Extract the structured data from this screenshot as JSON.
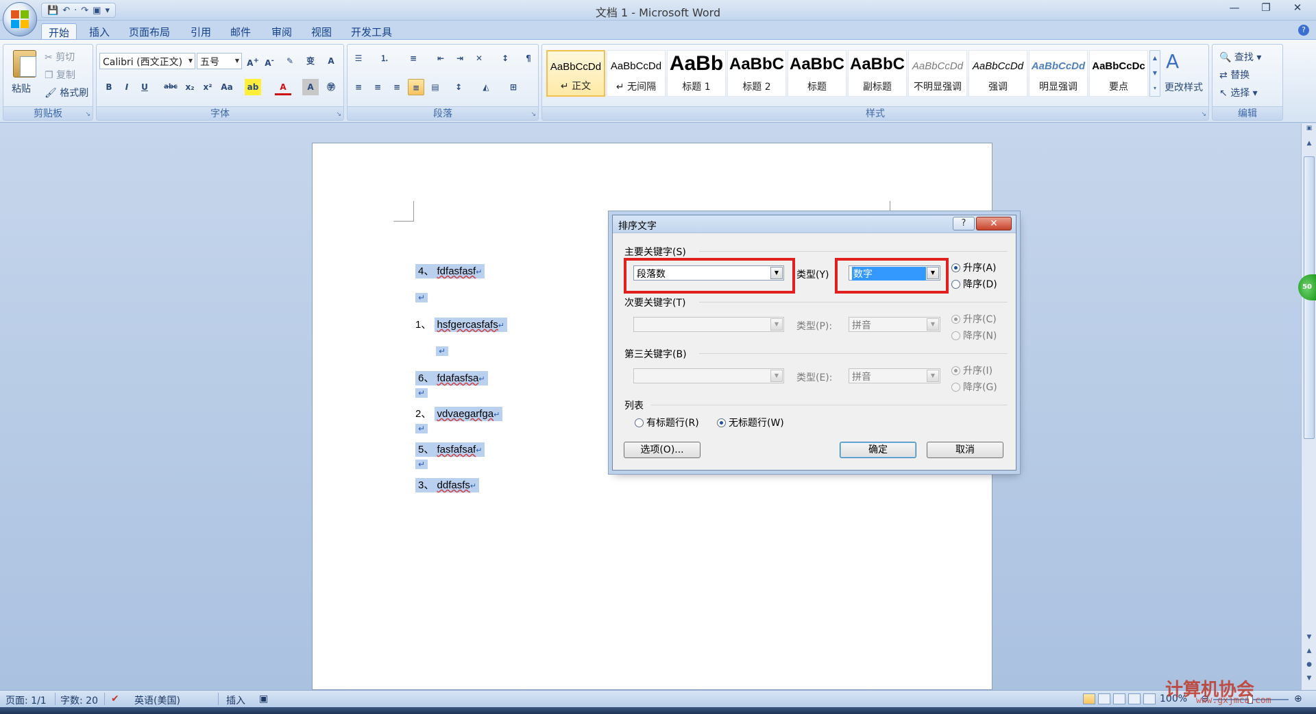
{
  "window": {
    "title": "文档 1 - Microsoft Word",
    "controls": [
      "—",
      "❐",
      "✕"
    ]
  },
  "qat": [
    "💾",
    "↶",
    "·",
    "↷",
    "▣",
    "▾"
  ],
  "tabs": [
    "开始",
    "插入",
    "页面布局",
    "引用",
    "邮件",
    "审阅",
    "视图",
    "开发工具"
  ],
  "ribbon": {
    "clipboard": {
      "label": "剪贴板",
      "paste": "粘贴",
      "cut": "剪切",
      "copy": "复制",
      "format_painter": "格式刷"
    },
    "font": {
      "label": "字体",
      "font_name": "Calibri (西文正文)",
      "font_size": "五号",
      "buttons": [
        "B",
        "I",
        "U",
        "abc",
        "x₂",
        "x²",
        "Aa"
      ]
    },
    "paragraph": {
      "label": "段落"
    },
    "styles": {
      "label": "样式",
      "items": [
        {
          "sample": "AaBbCcDd",
          "name": "↵ 正文"
        },
        {
          "sample": "AaBbCcDd",
          "name": "↵ 无间隔"
        },
        {
          "sample": "AaBb",
          "name": "标题 1"
        },
        {
          "sample": "AaBbC",
          "name": "标题 2"
        },
        {
          "sample": "AaBbC",
          "name": "标题"
        },
        {
          "sample": "AaBbC",
          "name": "副标题"
        },
        {
          "sample": "AaBbCcDd",
          "name": "不明显强调"
        },
        {
          "sample": "AaBbCcDd",
          "name": "强调"
        },
        {
          "sample": "AaBbCcDd",
          "name": "明显强调"
        },
        {
          "sample": "AaBbCcDc",
          "name": "要点"
        }
      ],
      "change_styles": "更改样式"
    },
    "editing": {
      "label": "编辑",
      "find": "查找",
      "replace": "替换",
      "select": "选择"
    }
  },
  "document": {
    "lines": [
      {
        "num": "4、",
        "text": "fdfasfasf"
      },
      {
        "num": "1、",
        "text": "hsfgercasfafs"
      },
      {
        "num": "6、",
        "text": "fdafasfsa"
      },
      {
        "num": "2、",
        "text": "vdvaegarfga"
      },
      {
        "num": "5、",
        "text": "fasfafsaf"
      },
      {
        "num": "3、",
        "text": "ddfasfs"
      }
    ],
    "para_mark": "↵"
  },
  "dialog": {
    "title": "排序文字",
    "help": "?",
    "close": "✕",
    "primary_label": "主要关键字(S)",
    "primary_key": "段落数",
    "type_label_1": "类型(Y)",
    "primary_type": "数字",
    "asc_1": "升序(A)",
    "desc_1": "降序(D)",
    "secondary_label": "次要关键字(T)",
    "type_label_2": "类型(P):",
    "secondary_type": "拼音",
    "asc_2": "升序(C)",
    "desc_2": "降序(N)",
    "third_label": "第三关键字(B)",
    "type_label_3": "类型(E):",
    "third_type": "拼音",
    "asc_3": "升序(I)",
    "desc_3": "降序(G)",
    "list_label": "列表",
    "has_header": "有标题行(R)",
    "no_header": "无标题行(W)",
    "options_btn": "选项(O)...",
    "ok_btn": "确定",
    "cancel_btn": "取消"
  },
  "status": {
    "page": "页面: 1/1",
    "words": "字数: 20",
    "language": "英语(美国)",
    "mode": "插入",
    "zoom": "100%"
  },
  "watermark": {
    "text": "计算机协会",
    "url": "www.gxjmca.com"
  },
  "colors": {
    "accent": "#15428b",
    "highlight_box": "#e01f1f",
    "selection": "#b9d0ef"
  }
}
